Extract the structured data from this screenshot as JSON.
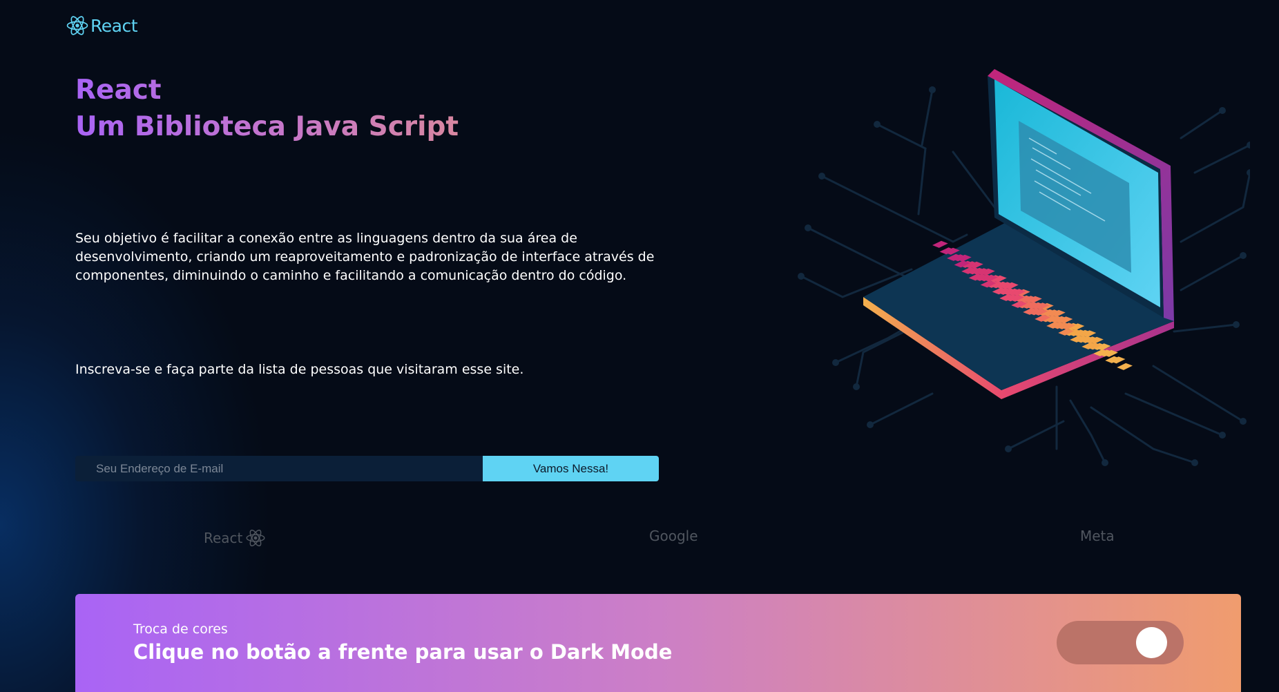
{
  "brand": {
    "name": "React",
    "icon": "react-atom-icon"
  },
  "hero": {
    "title_line1": "React",
    "title_line2": "Um Biblioteca Java Script",
    "description": "Seu objetivo é facilitar a conexão entre as linguagens dentro da sua área de desenvolvimento, criando um reaproveitamento e padronização de interface através de componentes, diminuindo o caminho e facilitando a comunicação dentro do código.",
    "subscribe_text": "Inscreva-se e faça parte da lista de pessoas que visitaram esse site."
  },
  "subscribe": {
    "placeholder": "Seu Endereço de E-mail",
    "value": "",
    "button_label": "Vamos Nessa!"
  },
  "partners": [
    {
      "label": "React",
      "icon": "react-atom-icon"
    },
    {
      "label": "Google"
    },
    {
      "label": "Meta"
    }
  ],
  "banner": {
    "kicker": "Troca de cores",
    "title": "Clique no botão a frente para usar o Dark Mode",
    "toggle_on": true
  },
  "colors": {
    "background": "#050b17",
    "accent_cyan": "#5fd3f3",
    "title_gradient_start": "#a964f5",
    "title_gradient_end": "#d887a0",
    "banner_gradient_start": "#a964f5",
    "banner_gradient_end": "#f09c6e",
    "toggle_track": "#bb7368"
  },
  "illustration": {
    "icon": "laptop-circuit-illustration"
  }
}
